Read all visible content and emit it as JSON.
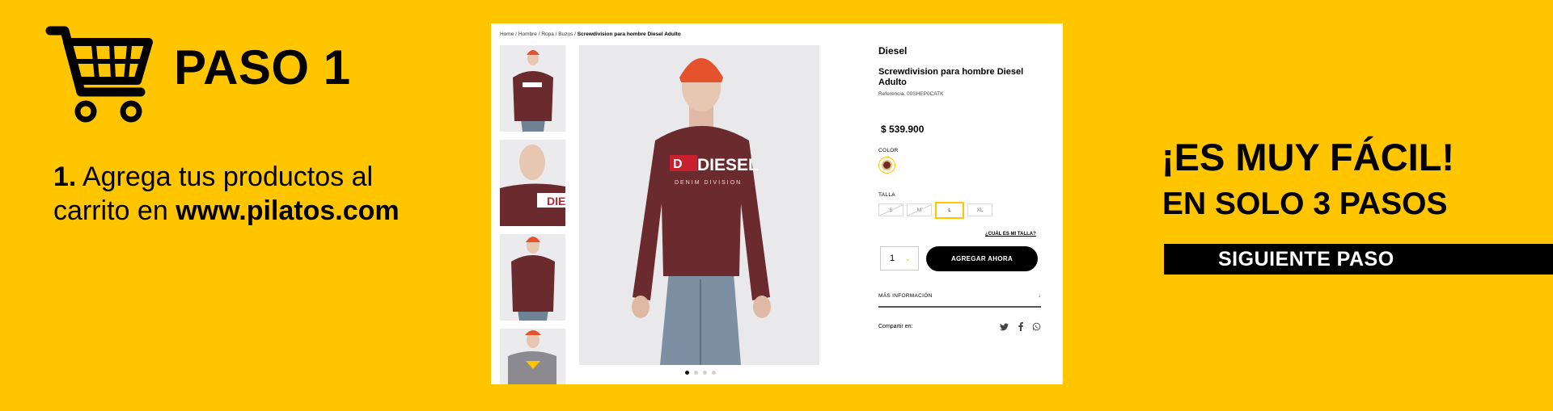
{
  "step": {
    "title": "PASO 1"
  },
  "instructions": {
    "number": "1.",
    "text1": "Agrega tus productos al",
    "text2": "carrito en",
    "url": "www.pilatos.com"
  },
  "breadcrumb": {
    "home": "Home",
    "men": "Hombre",
    "clothing": "Ropa",
    "category": "Buzos",
    "current": "Screwdivision para hombre Diesel Adulto"
  },
  "product": {
    "brand": "Diesel",
    "name": "Screwdivision para hombre Diesel Adulto",
    "reference": "Referencia: 00SHEP0CATK",
    "price": "$ 539.900",
    "color_label": "COLOR",
    "size_label": "TALLA",
    "sizes": [
      "S",
      "M",
      "L",
      "XL"
    ],
    "selected_size": "L",
    "size_guide": "¿CUÁL ES MI TALLA?",
    "quantity": "1",
    "add_button": "AGREGAR AHORA",
    "more_info": "MÁS INFORMACIÓN",
    "more_info_icon": "↓",
    "share_label": "Compartir en:",
    "share_icons": [
      "twitter-icon",
      "facebook-icon",
      "whatsapp-icon"
    ],
    "sweater_print": "DIESEL",
    "sweater_sub": "DENIM DIVISION"
  },
  "gallery": {
    "slides": 4,
    "active_slide": 1
  },
  "promo": {
    "line1": "¡ES MUY FÁCIL!",
    "line2": "EN SOLO 3 PASOS",
    "button": "SIGUIENTE PASO"
  },
  "colors": {
    "brand_yellow": "#FFC600",
    "black": "#000000",
    "sweater": "#6a2a2e"
  }
}
